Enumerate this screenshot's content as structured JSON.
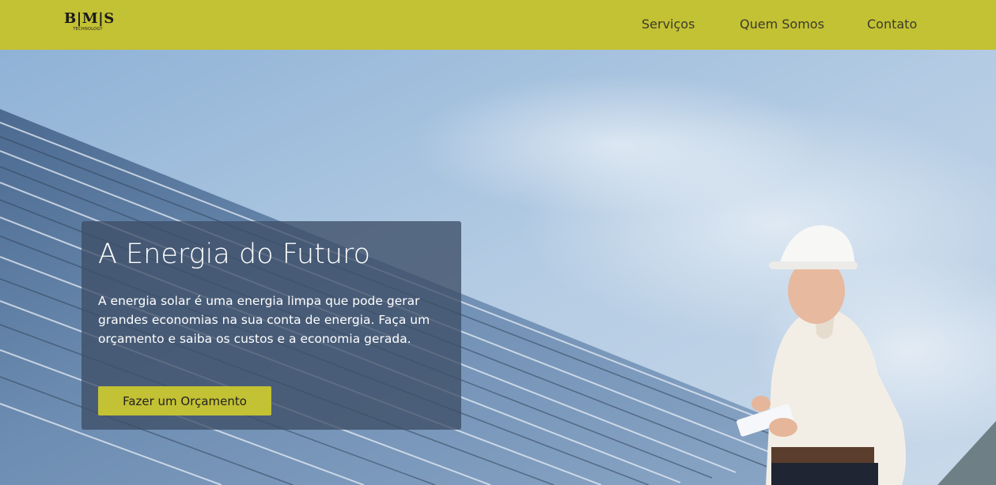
{
  "header": {
    "logo_text": "B|M|S",
    "logo_subtext": "TECHNOLOGY",
    "nav": [
      {
        "label": "Serviços"
      },
      {
        "label": "Quem Somos"
      },
      {
        "label": "Contato"
      }
    ]
  },
  "hero": {
    "title": "A Energia do Futuro",
    "text": "A energia solar é uma energia limpa que pode gerar grandes economias na sua conta de energia. Faça um orçamento e saiba os custos e a economia gerada.",
    "cta_label": "Fazer um Orçamento"
  },
  "colors": {
    "accent": "#c3c134",
    "card_bg": "#3e4e66",
    "sky": "#a9c2dc"
  },
  "icons": [
    "bms-logo"
  ]
}
